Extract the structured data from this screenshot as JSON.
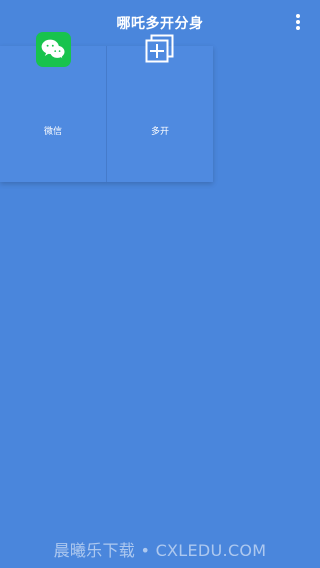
{
  "header": {
    "title": "哪吒多开分身"
  },
  "apps": [
    {
      "label": "微信",
      "icon": "wechat-icon"
    },
    {
      "label": "多开",
      "icon": "multi-open-icon"
    }
  ],
  "footer": {
    "watermark": "晨曦乐下载 • CXLEDU.COM"
  },
  "colors": {
    "background": "#4a86dc",
    "wechat_green": "#18c34d",
    "text": "#ffffff"
  }
}
